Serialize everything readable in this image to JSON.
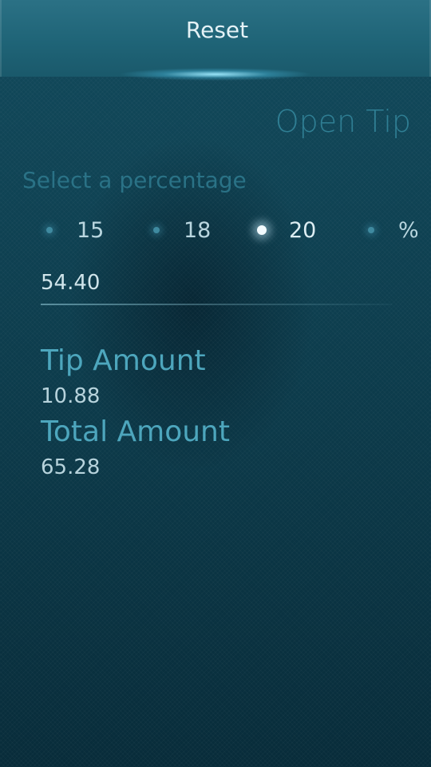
{
  "pulley_menu": {
    "reset_label": "Reset"
  },
  "page": {
    "title": "Open Tip",
    "select_label": "Select a percentage"
  },
  "percentages": {
    "options": [
      "15",
      "18",
      "20",
      "%"
    ],
    "selected": "20"
  },
  "bill": {
    "value": "54.40"
  },
  "results": {
    "tip_label": "Tip Amount",
    "tip_value": "10.88",
    "total_label": "Total Amount",
    "total_value": "65.28"
  },
  "colors": {
    "accent": "#4da6bd",
    "background": "#0c3a4a",
    "header": "#1f6477"
  }
}
